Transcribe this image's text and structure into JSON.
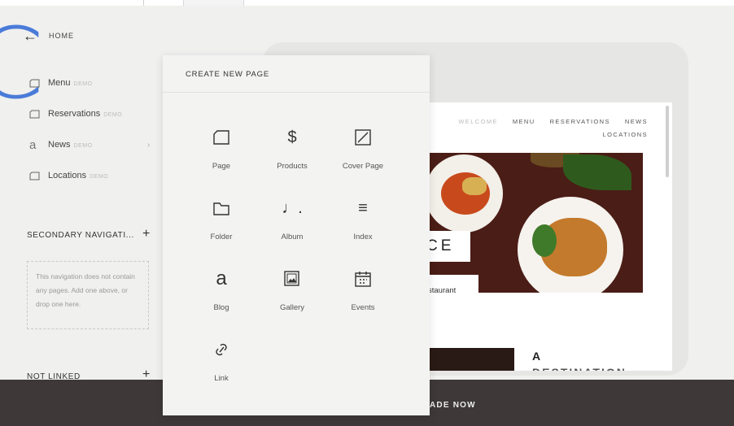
{
  "sidebar": {
    "back_label": "HOME",
    "items": [
      {
        "label": "Menu",
        "badge": "DEMO"
      },
      {
        "label": "Reservations",
        "badge": "DEMO"
      },
      {
        "label": "News",
        "badge": "DEMO"
      },
      {
        "label": "Locations",
        "badge": "DEMO"
      }
    ],
    "secondary_title": "SECONDARY NAVIGATI...",
    "secondary_empty_text": "This navigation does not contain any pages. Add one above, or drop one here.",
    "not_linked_title": "NOT LINKED"
  },
  "popover": {
    "title": "CREATE NEW PAGE",
    "tiles": [
      {
        "label": "Page",
        "icon": "page-icon"
      },
      {
        "label": "Products",
        "icon": "dollar-icon",
        "glyph": "$"
      },
      {
        "label": "Cover Page",
        "icon": "cover-page-icon"
      },
      {
        "label": "Folder",
        "icon": "folder-icon"
      },
      {
        "label": "Album",
        "icon": "music-note-icon",
        "glyph": "♩."
      },
      {
        "label": "Index",
        "icon": "index-lines-icon",
        "glyph": "≡"
      },
      {
        "label": "Blog",
        "icon": "blog-icon",
        "glyph": "a"
      },
      {
        "label": "Gallery",
        "icon": "gallery-icon"
      },
      {
        "label": "Events",
        "icon": "calendar-icon"
      },
      {
        "label": "Link",
        "icon": "link-icon"
      }
    ]
  },
  "preview": {
    "nav_row1": [
      "WELCOME",
      "MENU",
      "RESERVATIONS",
      "NEWS"
    ],
    "nav_row2": "LOCATIONS",
    "hero_partial_title": "CE",
    "hero_partial_subtitle": "staurant",
    "headline_partial": "A",
    "headline_partial2": "DESTINATION"
  },
  "footer": {
    "cta_partial": "ADE NOW"
  },
  "colors": {
    "accent_blue": "#4a7bd8",
    "footer_bg": "#3e3838",
    "hero_bg": "#4a1d16"
  }
}
